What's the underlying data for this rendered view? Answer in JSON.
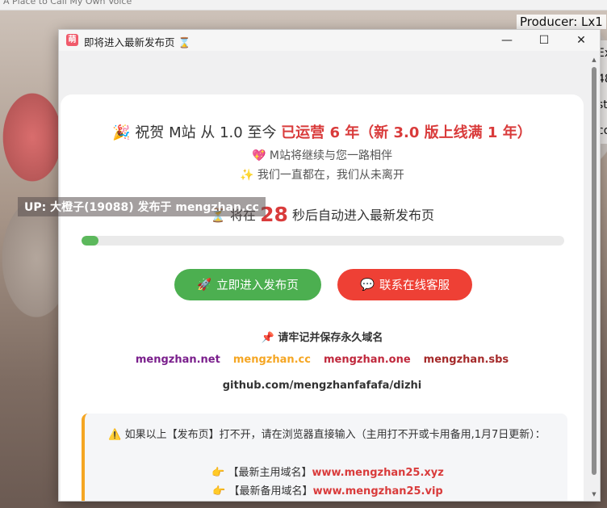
{
  "background": {
    "title": "A Place to Call My Own Voice",
    "producer_label": "Producer:  Lx1",
    "right_fragments": [
      "",
      "Ex",
      "48",
      "st",
      "co"
    ],
    "uploader_tag": "UP: 大橙子(19088) 发布于 mengzhan.cc"
  },
  "window": {
    "app_icon_text": "萌",
    "title": "即将进入最新发布页 ⌛",
    "minimize_label": "—",
    "maximize_label": "☐",
    "close_label": "✕"
  },
  "card": {
    "headline_prefix": "🎉 祝贺 M站 从 1.0 至今 ",
    "headline_emphasis": "已运营 6 年（新 3.0 版上线满 1 年）",
    "sub_line_1": "💖 M站将继续与您一路相伴",
    "sub_line_2": "✨ 我们一直都在，我们从未离开",
    "countdown_prefix": "⏳ 将在 ",
    "countdown_seconds": "28",
    "countdown_suffix": " 秒后自动进入最新发布页",
    "progress_fraction": 0.035,
    "btn_enter_icon": "🚀",
    "btn_enter_label": "立即进入发布页",
    "btn_service_icon": "💬",
    "btn_service_label": "联系在线客服",
    "domains_title": "📌 请牢记并保存永久域名",
    "domains": [
      {
        "text": "mengzhan.net",
        "color": "#7a1f8c"
      },
      {
        "text": "mengzhan.cc",
        "color": "#f5a623"
      },
      {
        "text": "mengzhan.one",
        "color": "#c0283c"
      },
      {
        "text": "mengzhan.sbs",
        "color": "#a52a2a"
      }
    ],
    "github": "github.com/mengzhanfafafa/dizhi",
    "notice_text": "⚠️ 如果以上【发布页】打不开，请在浏览器直接输入（主用打不开或卡用备用,1月7日更新）：",
    "notice_items": [
      {
        "prefix": "👉 【最新主用域名】",
        "link": "www.mengzhan25.xyz"
      },
      {
        "prefix": "👉 【最新备用域名】",
        "link": "www.mengzhan25.vip"
      }
    ]
  },
  "colors": {
    "accent_red": "#d93b3b",
    "green": "#4caf50",
    "red_button": "#ee4035",
    "notice_border": "#f5a623"
  }
}
